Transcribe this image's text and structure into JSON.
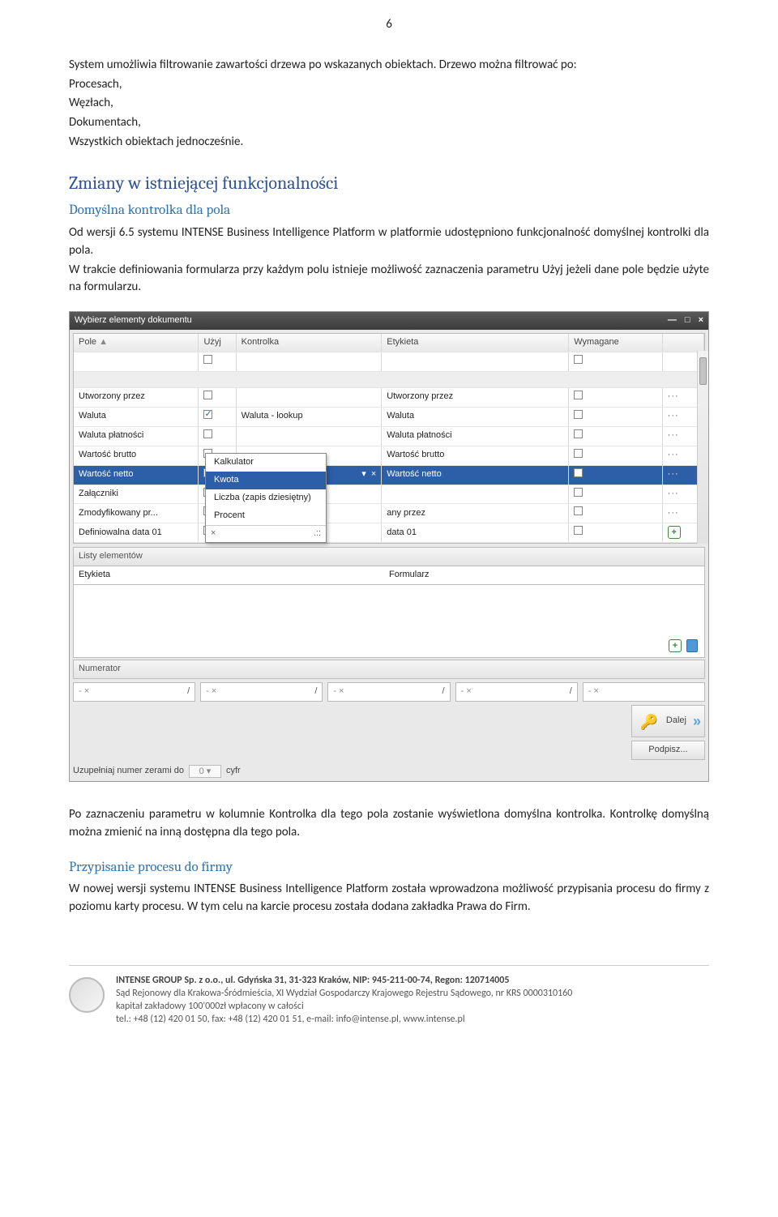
{
  "page_number": "6",
  "intro_para": "System umożliwia filtrowanie zawartości drzewa po wskazanych obiektach. Drzewo można filtrować po:",
  "intro_items": [
    "Procesach,",
    "Węzłach,",
    "Dokumentach,",
    "Wszystkich obiektach jednocześnie."
  ],
  "h1_1": "Zmiany w istniejącej funkcjonalności",
  "h2_1": "Domyślna kontrolka dla pola",
  "p1": "Od wersji 6.5 systemu INTENSE Business Intelligence Platform w platformie udostępniono funkcjonalność domyślnej kontrolki dla pola.",
  "p2": "W trakcie definiowania formularza przy każdym polu istnieje możliwość zaznaczenia parametru Użyj jeżeli dane pole będzie użyte na formularzu.",
  "app": {
    "title": "Wybierz elementy dokumentu",
    "columns": {
      "pole": "Pole",
      "uzyj": "Użyj",
      "kontrolka": "Kontrolka",
      "etykieta": "Etykieta",
      "wymagane": "Wymagane"
    },
    "rows": [
      {
        "pole": "",
        "uzyj": false,
        "ctrl": "",
        "et": "",
        "wym": false,
        "blank": true
      },
      {
        "pole": "Utworzony przez",
        "uzyj": false,
        "ctrl": "",
        "et": "Utworzony przez",
        "wym": false
      },
      {
        "pole": "Waluta",
        "uzyj": true,
        "ctrl": "Waluta - lookup",
        "et": "Waluta",
        "wym": false
      },
      {
        "pole": "Waluta płatności",
        "uzyj": false,
        "ctrl": "",
        "et": "Waluta płatności",
        "wym": false
      },
      {
        "pole": "Wartość brutto",
        "uzyj": false,
        "ctrl": "",
        "et": "Wartość brutto",
        "wym": false
      },
      {
        "pole": "Wartość netto",
        "uzyj": true,
        "ctrl": "Kwota",
        "et": "Wartość netto",
        "wym": false,
        "sel": true,
        "showdd": true
      },
      {
        "pole": "Załączniki",
        "uzyj": false,
        "ctrl": "",
        "et": "",
        "wym": false
      },
      {
        "pole": "Zmodyfikowany pr...",
        "uzyj": false,
        "ctrl": "",
        "et": "any przez",
        "wym": false
      },
      {
        "pole": "Definiowalna data 01",
        "uzyj": false,
        "ctrl": "",
        "et": "data 01",
        "wym": false
      }
    ],
    "dropdown": [
      "Kalkulator",
      "Kwota",
      "Liczba (zapis dziesiętny)",
      "Procent"
    ],
    "dropdown_sel": "Kwota",
    "section2_header": "Listy elementów",
    "section2_cols": {
      "et": "Etykieta",
      "form": "Formularz"
    },
    "section3_header": "Numerator",
    "numerator_fill_label": "Uzupełniaj numer zerami do",
    "numerator_fill_value": "0",
    "numerator_unit": "cyfr",
    "btn_next": "Dalej",
    "btn_sign": "Podpisz..."
  },
  "p3": "Po zaznaczeniu parametru w kolumnie Kontrolka dla tego pola zostanie wyświetlona domyślna kontrolka. Kontrolkę domyślną można zmienić na inną dostępna dla tego pola.",
  "h2_2": "Przypisanie procesu do firmy",
  "p4": "W nowej wersji systemu INTENSE Business Intelligence Platform została wprowadzona możliwość przypisania procesu do firmy z poziomu karty procesu. W tym celu na karcie procesu została dodana zakładka Prawa do Firm.",
  "footer": {
    "l1": "INTENSE GROUP  Sp. z o.o., ul. Gdyńska 31, 31-323 Kraków, NIP: 945-211-00-74, Regon: 120714005",
    "l2": "Sąd Rejonowy dla Krakowa-Śródmieścia, XI Wydział Gospodarczy Krajowego Rejestru Sądowego, nr KRS 0000310160",
    "l3": "kapitał zakładowy 100'000zł wpłacony w całości",
    "l4": "tel.: +48 (12) 420 01 50, fax: +48 (12) 420 01 51, e-mail: info@intense.pl, www.intense.pl"
  }
}
